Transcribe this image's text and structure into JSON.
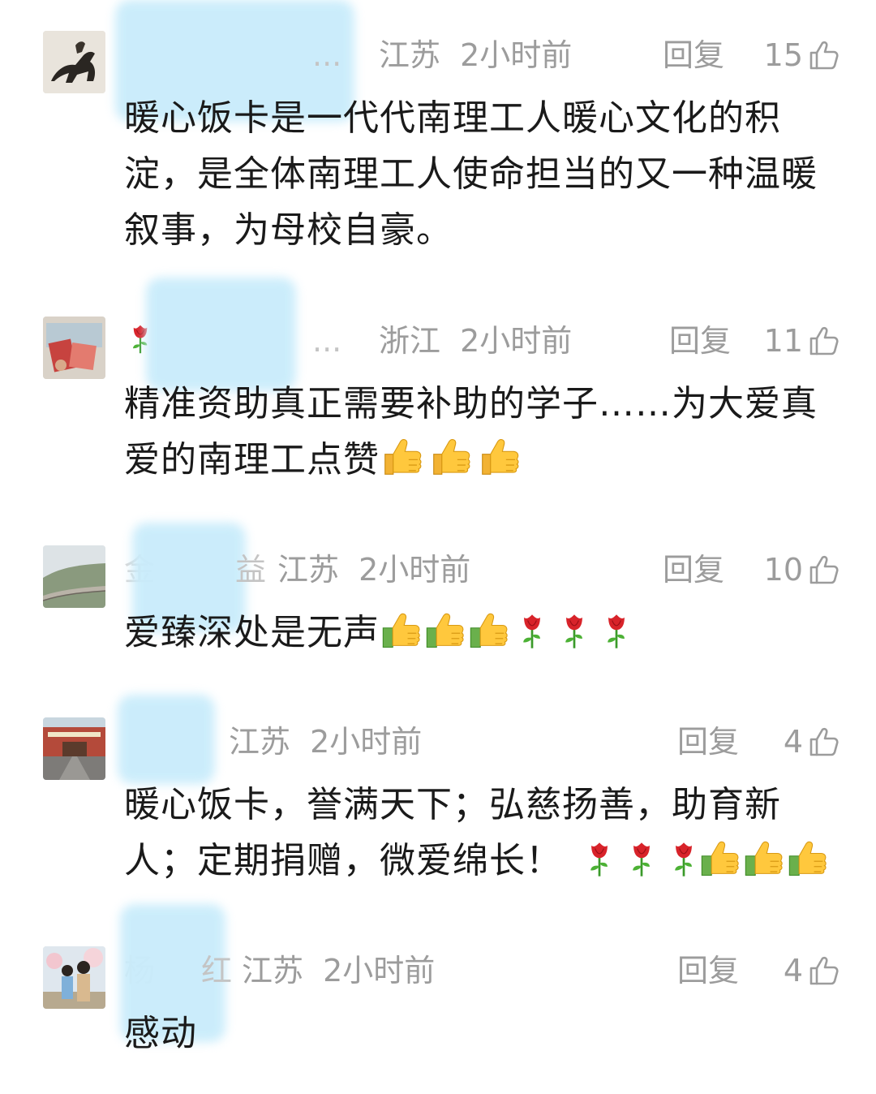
{
  "comments": [
    {
      "name_fragment": "... ",
      "location": "江苏",
      "time": "2小时前",
      "reply_label": "回复",
      "like_count": "15",
      "text_lines": [
        "暖心饭卡是一代代南理工人暖心文化的积",
        "淀，是全体南理工人使命担当的又一种温暖",
        "叙事，为母校自豪。"
      ]
    },
    {
      "name_fragment": "... ",
      "location": "浙江",
      "time": "2小时前",
      "reply_label": "回复",
      "like_count": "11",
      "text_lines": [
        "精准资助真正需要补助的学子……为大爱真",
        "爱的南理工点赞"
      ]
    },
    {
      "name_fragment": "益",
      "location": "江苏",
      "time": "2小时前",
      "reply_label": "回复",
      "like_count": "10",
      "text_lines": [
        "爱臻深处是无声"
      ]
    },
    {
      "name_fragment": "",
      "location": "江苏",
      "time": "2小时前",
      "reply_label": "回复",
      "like_count": "4",
      "text_lines": [
        "暖心饭卡，誉满天下；弘慈扬善，助育新",
        "人；定期捐赠，微爱绵长！"
      ]
    },
    {
      "name_fragment": "红",
      "location": "江苏",
      "time": "2小时前",
      "reply_label": "回复",
      "like_count": "4",
      "text_lines": [
        "感动"
      ]
    }
  ],
  "icons": {
    "like": "thumbs-up-outline-icon",
    "emoji_thumb": "thumbs-up-emoji",
    "emoji_rose": "rose-emoji"
  },
  "colors": {
    "meta_text": "#9c9c9c",
    "body_text": "#1a1a1a",
    "name_blur": "#c9ecfb"
  }
}
